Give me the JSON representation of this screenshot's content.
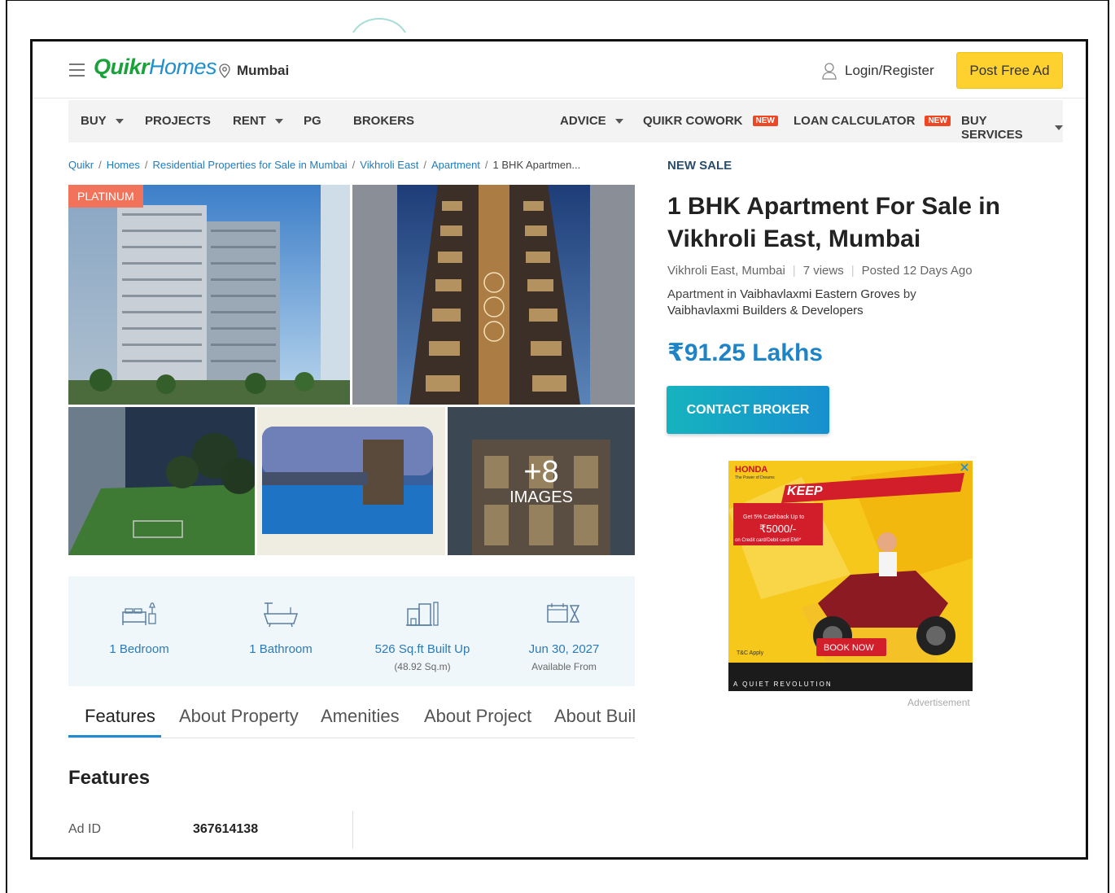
{
  "header": {
    "logo_part1": "Quikr",
    "logo_part2": "Homes",
    "city": "Mumbai",
    "login_label": "Login/Register",
    "post_ad_label": "Post Free Ad"
  },
  "nav": {
    "buy": "BUY",
    "projects": "PROJECTS",
    "rent": "RENT",
    "pg": "PG",
    "brokers": "BROKERS",
    "advice": "ADVICE",
    "cowork": "QUIKR COWORK",
    "loan": "LOAN CALCULATOR",
    "buy_services": "BUY SERVICES",
    "new_badge": "NEW"
  },
  "breadcrumb": [
    "Quikr",
    "Homes",
    "Residential Properties for Sale in Mumbai",
    "Vikhroli East",
    "Apartment",
    "1 BHK Apartmen..."
  ],
  "gallery": {
    "badge": "PLATINUM",
    "more_count": "+8",
    "more_label": "IMAGES"
  },
  "stats": [
    {
      "value": "1 Bedroom",
      "sub": ""
    },
    {
      "value": "1 Bathroom",
      "sub": ""
    },
    {
      "value": "526 Sq.ft Built Up",
      "sub": "(48.92 Sq.m)"
    },
    {
      "value": "Jun 30, 2027",
      "sub": "Available From"
    }
  ],
  "tabs": [
    "Features",
    "About Property",
    "Amenities",
    "About Project",
    "About Builder"
  ],
  "features": {
    "heading": "Features",
    "ad_id_label": "Ad ID",
    "ad_id_value": "367614138"
  },
  "listing": {
    "sale_type": "NEW SALE",
    "title": "1 BHK Apartment For Sale in Vikhroli East, Mumbai",
    "location": "Vikhroli East, Mumbai",
    "views": "7 views",
    "posted": "Posted 12 Days Ago",
    "desc_prefix": "Apartment in",
    "project": "Vaibhavlaxmi Eastern Groves",
    "desc_by": "by",
    "builder": "Vaibhavlaxmi Builders & Developers",
    "price": "₹91.25 Lakhs",
    "contact_label": "CONTACT BROKER"
  },
  "ad": {
    "brand": "HONDA",
    "tagline": "The Power of Dreams",
    "headline": "KEEP",
    "offer": "Get 5% Cashback Up to",
    "amount": "₹5000/-",
    "offer_sub": "on Credit card/Debit card EMI*",
    "tnc": "T&C Apply",
    "cta": "BOOK NOW",
    "footer": "A QUIET REVOLUTION",
    "caption": "Advertisement"
  },
  "colors": {
    "accent_blue": "#1f84c6",
    "post_ad_yellow": "#ffd12e",
    "platinum": "#f0735a",
    "new_badge": "#ef4723"
  }
}
